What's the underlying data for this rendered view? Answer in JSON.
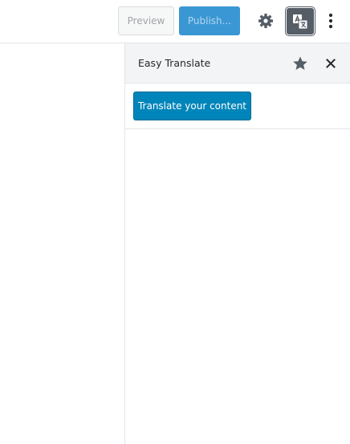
{
  "toolbar": {
    "preview_label": "Preview",
    "publish_label": "Publish...",
    "settings_icon": "gear-icon",
    "translate_icon": "translate-icon",
    "more_icon": "more-vertical-icon"
  },
  "sidebar": {
    "title": "Easy Translate",
    "star_icon": "star-icon",
    "close_icon": "close-icon",
    "translate_button_label": "Translate your content"
  },
  "colors": {
    "primary": "#0085ba",
    "publish_disabled": "#3a97d4",
    "active_icon_bg": "#555d66",
    "header_bg": "#f3f4f5"
  }
}
